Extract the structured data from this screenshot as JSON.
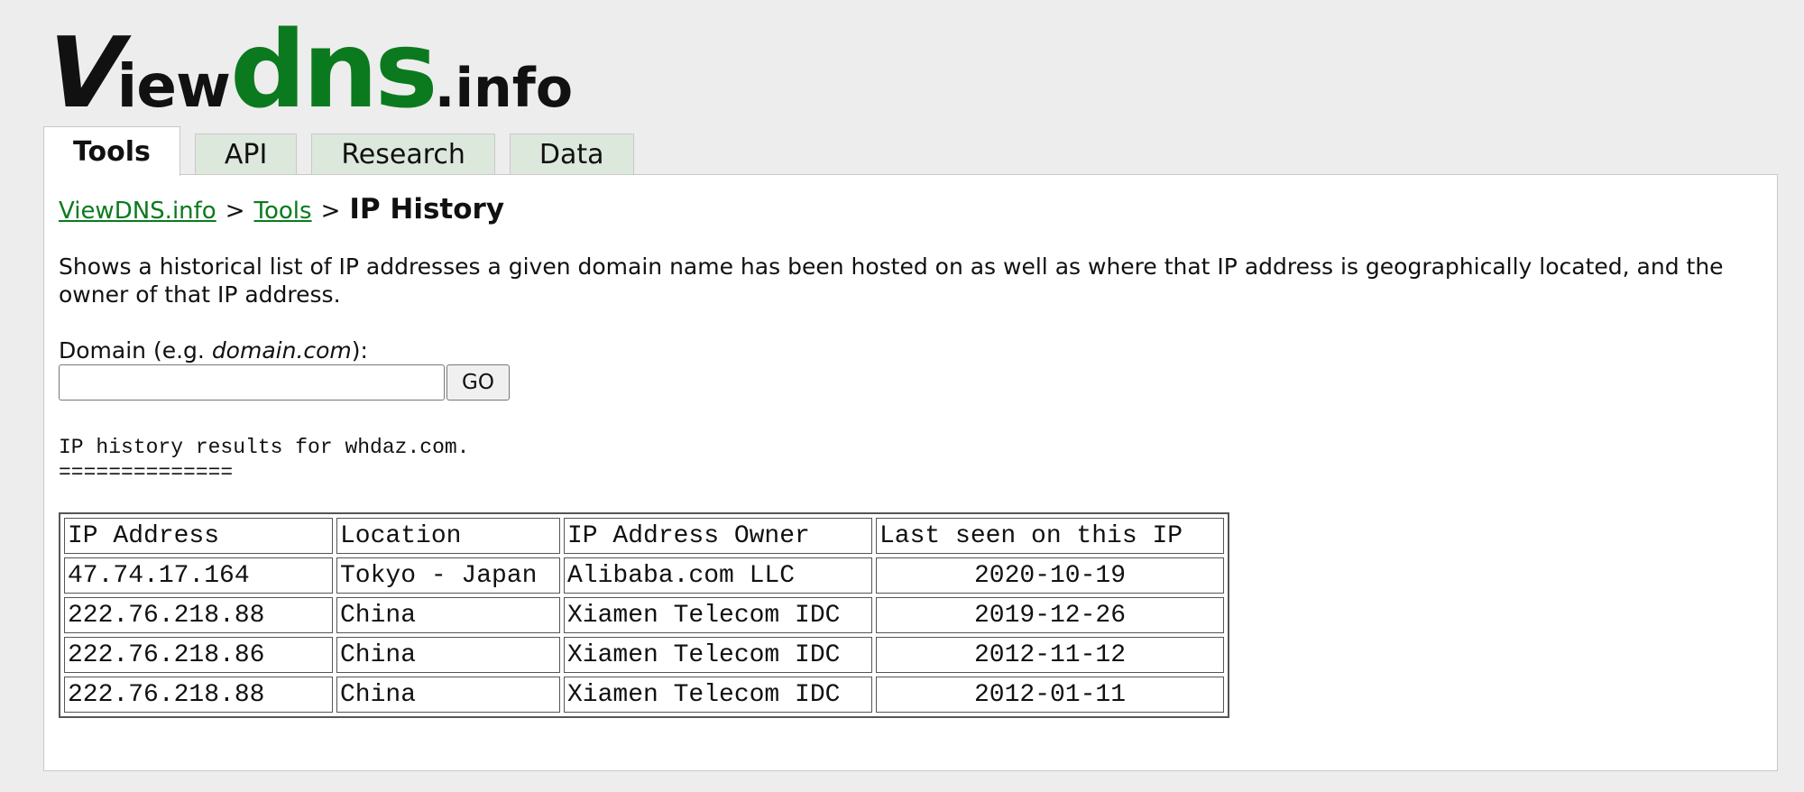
{
  "logo": {
    "part_v": "V",
    "part_iew": "iew",
    "part_dns": "dns",
    "part_tld": ".info"
  },
  "tabs": [
    {
      "label": "Tools",
      "active": true
    },
    {
      "label": "API",
      "active": false
    },
    {
      "label": "Research",
      "active": false
    },
    {
      "label": "Data",
      "active": false
    }
  ],
  "breadcrumb": {
    "home": "ViewDNS.info",
    "separator": ">",
    "section": "Tools",
    "current": "IP History"
  },
  "description": "Shows a historical list of IP addresses a given domain name has been hosted on as well as where that IP address is geographically located, and the owner of that IP address.",
  "form": {
    "label_prefix": "Domain (e.g. ",
    "label_example": "domain.com",
    "label_suffix": "):",
    "input_value": "",
    "go_label": "GO"
  },
  "results": {
    "heading": "IP history results for whdaz.com.",
    "underline": "==============",
    "columns": [
      "IP Address",
      "Location",
      "IP Address Owner",
      "Last seen on this IP"
    ],
    "rows": [
      {
        "ip": "47.74.17.164",
        "location": "Tokyo - Japan",
        "owner": "Alibaba.com LLC",
        "last_seen": "2020-10-19"
      },
      {
        "ip": "222.76.218.88",
        "location": "China",
        "owner": "Xiamen Telecom IDC",
        "last_seen": "2019-12-26"
      },
      {
        "ip": "222.76.218.86",
        "location": "China",
        "owner": "Xiamen Telecom IDC",
        "last_seen": "2012-11-12"
      },
      {
        "ip": "222.76.218.88",
        "location": "China",
        "owner": "Xiamen Telecom IDC",
        "last_seen": "2012-01-11"
      }
    ]
  },
  "colors": {
    "brand_green": "#0b7a1e",
    "page_background": "#ededed",
    "tab_background": "#dde8dd"
  }
}
